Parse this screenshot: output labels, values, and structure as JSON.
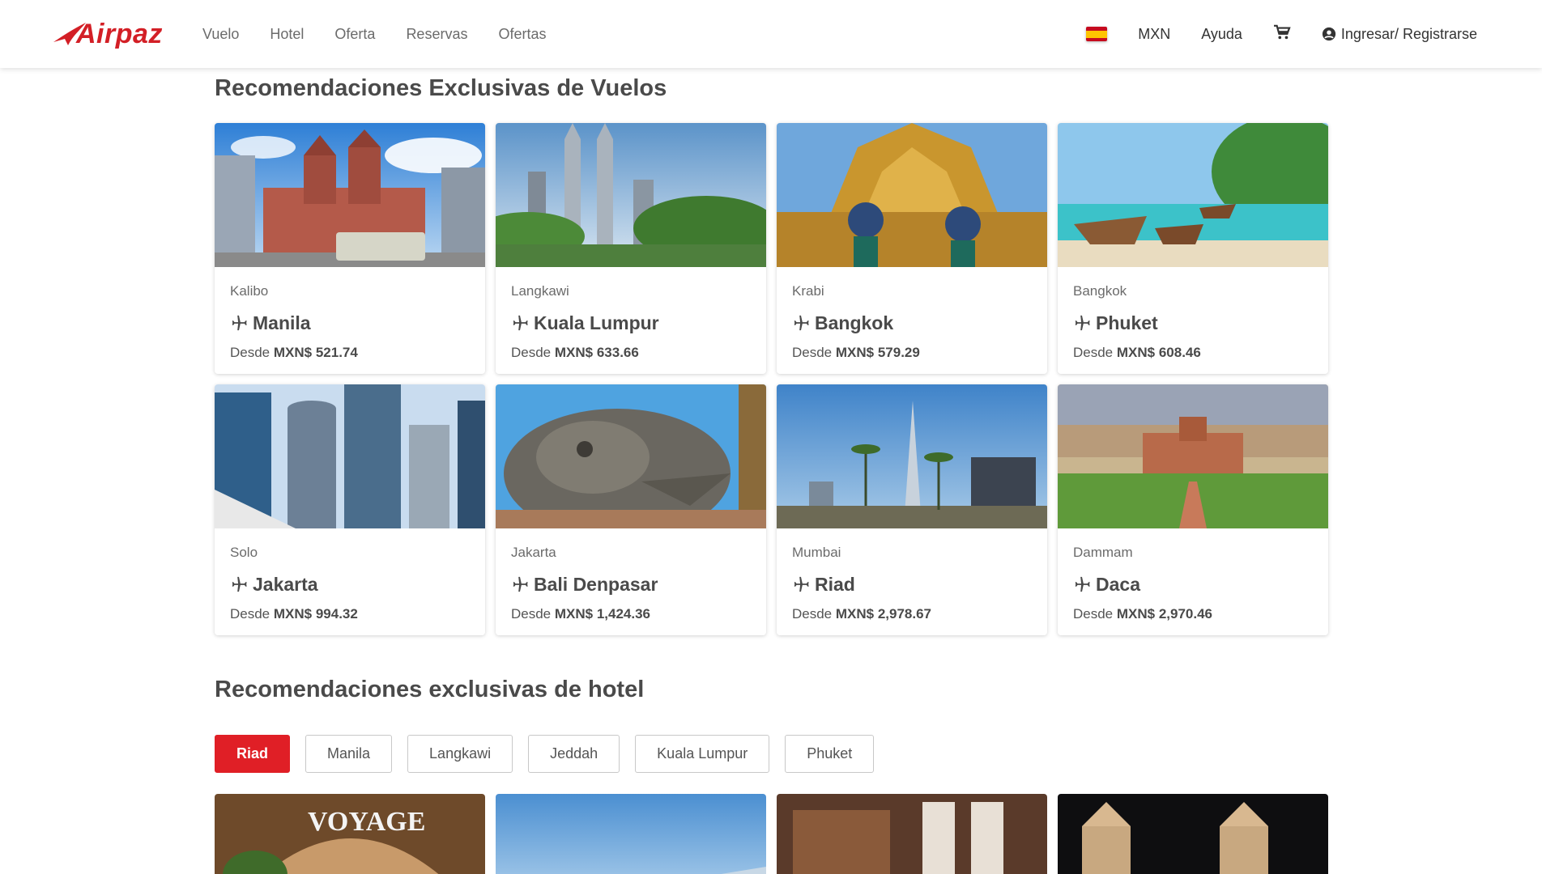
{
  "header": {
    "logo": "Airpaz",
    "nav": [
      "Vuelo",
      "Hotel",
      "Oferta",
      "Reservas",
      "Ofertas"
    ],
    "currency": "MXN",
    "help": "Ayuda",
    "login": "Ingresar/ Registrarse"
  },
  "flights": {
    "title": "Recomendaciones Exclusivas de Vuelos",
    "price_prefix": "Desde",
    "cards": [
      {
        "origin": "Kalibo",
        "destination": "Manila",
        "price": "MXN$ 521.74"
      },
      {
        "origin": "Langkawi",
        "destination": "Kuala Lumpur",
        "price": "MXN$ 633.66"
      },
      {
        "origin": "Krabi",
        "destination": "Bangkok",
        "price": "MXN$ 579.29"
      },
      {
        "origin": "Bangkok",
        "destination": "Phuket",
        "price": "MXN$ 608.46"
      },
      {
        "origin": "Solo",
        "destination": "Jakarta",
        "price": "MXN$ 994.32"
      },
      {
        "origin": "Jakarta",
        "destination": "Bali Denpasar",
        "price": "MXN$ 1,424.36"
      },
      {
        "origin": "Mumbai",
        "destination": "Riad",
        "price": "MXN$ 2,978.67"
      },
      {
        "origin": "Dammam",
        "destination": "Daca",
        "price": "MXN$ 2,970.46"
      }
    ]
  },
  "hotels": {
    "title": "Recomendaciones exclusivas de hotel",
    "tabs": [
      "Riad",
      "Manila",
      "Langkawi",
      "Jeddah",
      "Kuala Lumpur",
      "Phuket"
    ],
    "active_tab": "Riad",
    "first_card_sign": "VOYAGE"
  },
  "colors": {
    "brand": "#d31f26",
    "active_tab": "#e01f26"
  }
}
